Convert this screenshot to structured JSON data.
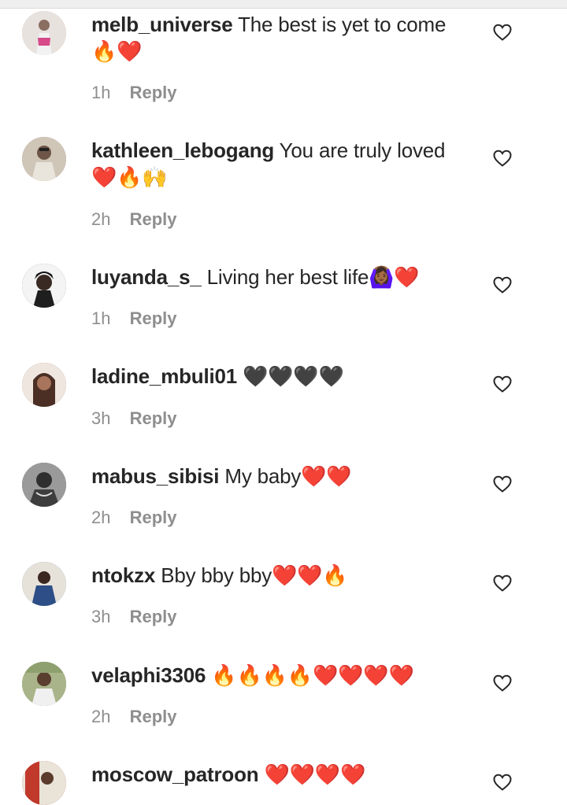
{
  "comments": [
    {
      "username": "melb_universe",
      "text": "The best is yet to come",
      "emoji": "🔥❤️",
      "time": "1h",
      "reply": "Reply",
      "avatar_color": "#b8a7a3"
    },
    {
      "username": "kathleen_lebogang",
      "text": "You are truly loved",
      "emoji": "❤️🔥🙌",
      "time": "2h",
      "reply": "Reply",
      "avatar_color": "#8c7b6c"
    },
    {
      "username": "luyanda_s_",
      "text": "Living her best life",
      "emoji": "🙆🏾‍♀️❤️",
      "time": "1h",
      "reply": "Reply",
      "avatar_color": "#2f2a28"
    },
    {
      "username": "ladine_mbuli01",
      "text": "",
      "emoji": "🖤🖤🖤🖤",
      "time": "3h",
      "reply": "Reply",
      "avatar_color": "#6b4a3a"
    },
    {
      "username": "mabus_sibisi",
      "text": "My baby",
      "emoji": "❤️❤️",
      "time": "2h",
      "reply": "Reply",
      "avatar_color": "#4a4a4a"
    },
    {
      "username": "ntokzx",
      "text": "Bby bby bby",
      "emoji": "❤️❤️🔥",
      "time": "3h",
      "reply": "Reply",
      "avatar_color": "#3b5f8a"
    },
    {
      "username": "velaphi3306",
      "text": "",
      "emoji": "🔥🔥🔥🔥❤️❤️❤️❤️",
      "time": "2h",
      "reply": "Reply",
      "avatar_color": "#7d8a5a"
    },
    {
      "username": "moscow_patroon",
      "text": "",
      "emoji": "❤️❤️❤️❤️",
      "time": "",
      "reply": "",
      "avatar_color": "#c0392b"
    }
  ],
  "icons": {
    "like": "heart-outline-icon"
  }
}
